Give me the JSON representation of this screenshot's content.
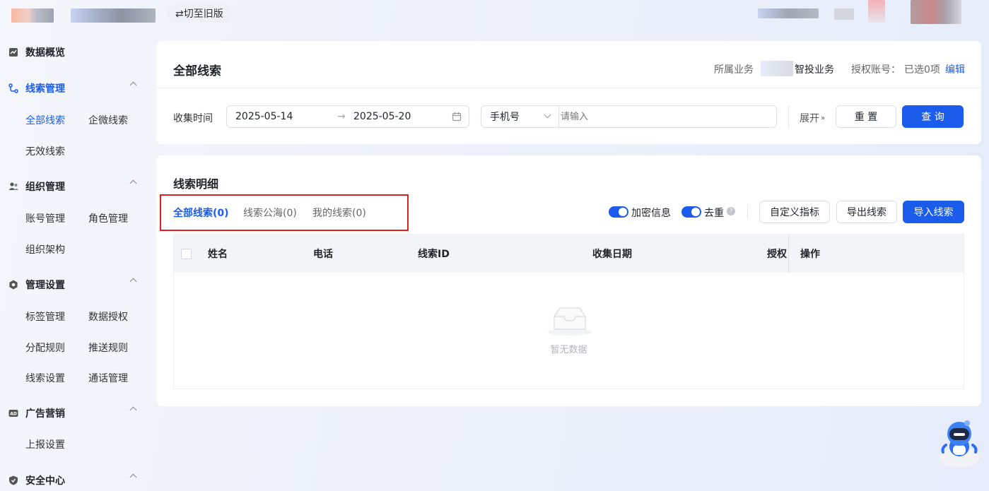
{
  "topbar": {
    "switch_old": "⇄切至旧版"
  },
  "sidebar": {
    "data_overview": "数据概览",
    "clue_mgmt": {
      "label": "线索管理",
      "items": [
        "全部线索",
        "企微线索",
        "无效线索"
      ]
    },
    "org_mgmt": {
      "label": "组织管理",
      "items": [
        "账号管理",
        "角色管理",
        "组织架构"
      ]
    },
    "settings": {
      "label": "管理设置",
      "items": [
        "标签管理",
        "数据授权",
        "分配规则",
        "推送规则",
        "线索设置",
        "通话管理"
      ]
    },
    "ads": {
      "label": "广告营销",
      "items": [
        "上报设置"
      ]
    },
    "security": {
      "label": "安全中心"
    }
  },
  "header": {
    "title": "全部线索",
    "business_label": "所属业务",
    "business_value": "智投业务",
    "auth_label": "授权账号：",
    "auth_value": "已选0项",
    "edit": "编辑"
  },
  "filter": {
    "collect_time_label": "收集时间",
    "start_date": "2025-05-14",
    "end_date": "2025-05-20",
    "field_select": "手机号",
    "input_placeholder": "请输入",
    "expand": "展开",
    "reset": "重 置",
    "query": "查 询"
  },
  "detail": {
    "title": "线索明细",
    "tabs": [
      "全部线索(0)",
      "线索公海(0)",
      "我的线索(0)"
    ],
    "encrypt_label": "加密信息",
    "dedupe_label": "去重",
    "custom_metrics": "自定义指标",
    "export": "导出线索",
    "import": "导入线索",
    "columns": [
      "姓名",
      "电话",
      "线索ID",
      "收集日期",
      "授权",
      "操作"
    ],
    "empty": "暂无数据"
  },
  "colors": {
    "accent": "#1b5ced",
    "highlight": "#e02020"
  }
}
